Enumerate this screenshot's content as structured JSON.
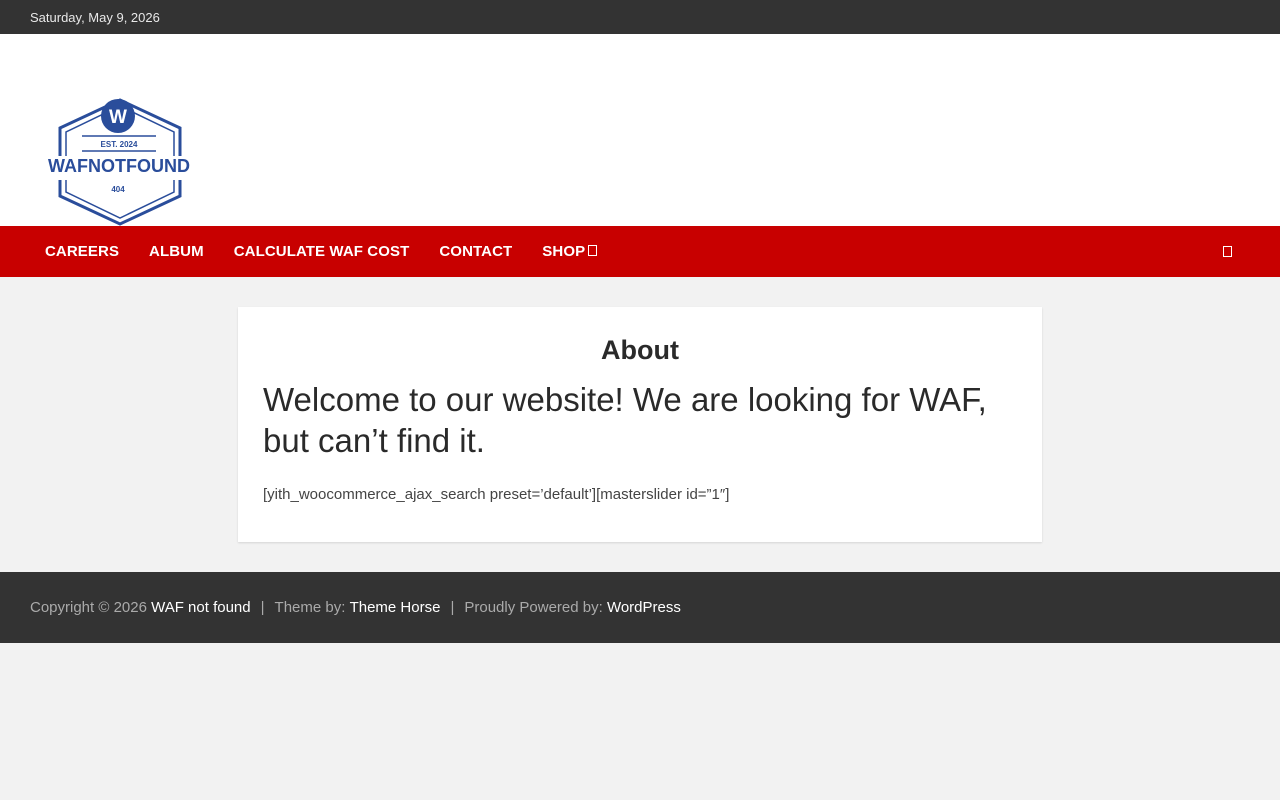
{
  "topbar": {
    "date": "Saturday, May 9, 2026"
  },
  "logo": {
    "badge_letter": "W",
    "est": "EST. 2024",
    "name": "WAFNOTFOUND",
    "code": "404"
  },
  "nav": {
    "items": [
      {
        "label": "CAREERS"
      },
      {
        "label": "ALBUM"
      },
      {
        "label": "CALCULATE WAF COST"
      },
      {
        "label": "CONTACT"
      },
      {
        "label": "SHOP"
      }
    ]
  },
  "page": {
    "title": "About",
    "heading": "Welcome to our website! We are looking for WAF, but can’t find it.",
    "shortcode": "[yith_woocommerce_ajax_search preset=’default’][masterslider id=”1″]"
  },
  "footer": {
    "copyright_prefix": "Copyright © 2026",
    "site_link": "WAF not found",
    "sep1": "|",
    "theme_prefix": "Theme by:",
    "theme_link": "Theme Horse",
    "sep2": "|",
    "powered_prefix": "Proudly Powered by:",
    "powered_link": "WordPress"
  },
  "colors": {
    "topbar": "#333333",
    "nav": "#c80000",
    "logo_blue": "#2a4d9b",
    "footer": "#333333"
  }
}
